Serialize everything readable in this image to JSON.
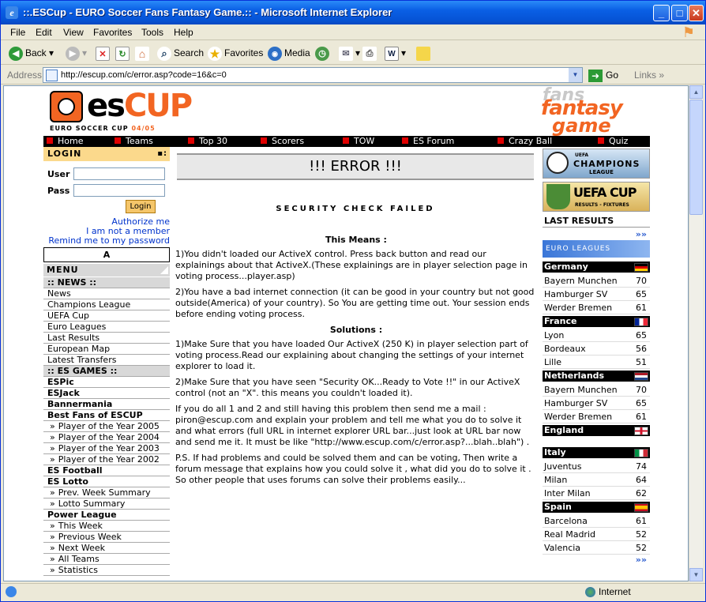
{
  "window": {
    "title": "::.ESCup - EURO Soccer Fans Fantasy Game.::  - Microsoft Internet Explorer"
  },
  "menubar": [
    "File",
    "Edit",
    "View",
    "Favorites",
    "Tools",
    "Help"
  ],
  "toolbar": {
    "back": "Back",
    "search": "Search",
    "favorites": "Favorites",
    "media": "Media"
  },
  "address": {
    "label": "Address",
    "url": "http://escup.com/c/error.asp?code=16&c=0",
    "go": "Go",
    "links": "Links"
  },
  "status": {
    "zone": "Internet"
  },
  "site": {
    "logo": {
      "es": "es",
      "cup": "CUP",
      "sub": "EURO SOCCER CUP",
      "season": "04/05"
    },
    "fflogo": {
      "l1": "fans",
      "l2": "fantasy",
      "l3": "game"
    },
    "nav": [
      "Home",
      "Teams",
      "Top 30",
      "Scorers",
      "TOW",
      "ES Forum",
      "Crazy Ball",
      "Quiz"
    ]
  },
  "left": {
    "login_title": "LOGIN",
    "user_label": "User",
    "pass_label": "Pass",
    "login_button": "Login",
    "links": [
      "Authorize me",
      "I am not a member",
      "Remind me to my password"
    ],
    "a_box": "A",
    "menu_title": "MENU",
    "menu": [
      {
        "t": "sec",
        "label": ":: NEWS ::"
      },
      {
        "t": "item",
        "label": "News"
      },
      {
        "t": "item",
        "label": "Champions League"
      },
      {
        "t": "item",
        "label": "UEFA Cup"
      },
      {
        "t": "item",
        "label": "Euro Leagues"
      },
      {
        "t": "item",
        "label": "Last Results"
      },
      {
        "t": "item",
        "label": "European Map"
      },
      {
        "t": "item",
        "label": "Latest Transfers"
      },
      {
        "t": "sec",
        "label": ":: ES GAMES ::"
      },
      {
        "t": "bold",
        "label": "ESPic"
      },
      {
        "t": "bold",
        "label": "ESJack"
      },
      {
        "t": "bold",
        "label": "Bannermania"
      },
      {
        "t": "bold",
        "label": "Best Fans of ESCUP"
      },
      {
        "t": "sub",
        "label": "Player of the Year 2005"
      },
      {
        "t": "sub",
        "label": "Player of the Year 2004"
      },
      {
        "t": "sub",
        "label": "Player of the Year 2003"
      },
      {
        "t": "sub",
        "label": "Player of the Year 2002"
      },
      {
        "t": "bold",
        "label": "ES Football"
      },
      {
        "t": "bold",
        "label": "ES Lotto"
      },
      {
        "t": "sub",
        "label": "Prev. Week Summary"
      },
      {
        "t": "sub",
        "label": "Lotto Summary"
      },
      {
        "t": "bold",
        "label": "Power League"
      },
      {
        "t": "sub",
        "label": "This Week"
      },
      {
        "t": "sub",
        "label": "Previous Week"
      },
      {
        "t": "sub",
        "label": "Next Week"
      },
      {
        "t": "sub",
        "label": "All Teams"
      },
      {
        "t": "sub",
        "label": "Statistics"
      }
    ]
  },
  "center": {
    "error_title": "!!! ERROR !!!",
    "security": "SECURITY CHECK FAILED",
    "means_title": "This Means :",
    "means": [
      "1)You didn't loaded our ActiveX control. Press back button and read our explainings about that ActiveX.(These explainings are in player selection page in voting process...player.asp)",
      "2)You have a bad internet connection (it can be good in your country but not good outside(America) of your country). So You are getting time out. Your session ends before ending voting process."
    ],
    "solutions_title": "Solutions :",
    "solutions": [
      "1)Make Sure that you have loaded Our ActiveX (250 K) in player selection part of voting process.Read our explaining about changing the settings of your internet explorer to load it.",
      "2)Make Sure that you have seen \"Security OK...Ready to Vote !!\" in our ActiveX control (not an \"X\". this means you couldn't loaded it).",
      "If you do all 1 and 2 and still having this problem then send me a mail : piron@escup.com and explain your problem and tell me what you do to solve it and what errors (full URL in internet explorer URL bar...just look at URL bar now and send me it. It must be like \"http://www.escup.com/c/error.asp?...blah..blah\") .",
      "P.S. If had problems and could be solved them and can be voting, Then write a forum message that explains how you could solve it , what did you do to solve it . So other people that uses forums can solve their problems easily..."
    ]
  },
  "right": {
    "cl": {
      "t1": "UEFA",
      "t2": "CHAMPIONS",
      "t3": "LEAGUE"
    },
    "uc": {
      "t2": "UEFA CUP",
      "t3": "RESULTS - FIXTURES"
    },
    "last_results": "LAST RESULTS",
    "more": "»»",
    "euro_leagues": "EURO LEAGUES",
    "leagues": [
      {
        "country": "Germany",
        "flag": "de",
        "teams": [
          {
            "n": "Bayern Munchen",
            "p": "70"
          },
          {
            "n": "Hamburger SV",
            "p": "65"
          },
          {
            "n": "Werder Bremen",
            "p": "61"
          }
        ]
      },
      {
        "country": "France",
        "flag": "fr",
        "teams": [
          {
            "n": "Lyon",
            "p": "65"
          },
          {
            "n": "Bordeaux",
            "p": "56"
          },
          {
            "n": "Lille",
            "p": "51"
          }
        ]
      },
      {
        "country": "Netherlands",
        "flag": "nl",
        "teams": [
          {
            "n": "Bayern Munchen",
            "p": "70"
          },
          {
            "n": "Hamburger SV",
            "p": "65"
          },
          {
            "n": "Werder Bremen",
            "p": "61"
          }
        ]
      },
      {
        "country": "England",
        "flag": "en",
        "teams": []
      },
      {
        "country": "Italy",
        "flag": "it",
        "teams": [
          {
            "n": "Juventus",
            "p": "74"
          },
          {
            "n": "Milan",
            "p": "64"
          },
          {
            "n": "Inter Milan",
            "p": "62"
          }
        ]
      },
      {
        "country": "Spain",
        "flag": "es",
        "teams": [
          {
            "n": "Barcelona",
            "p": "61"
          },
          {
            "n": "Real Madrid",
            "p": "52"
          },
          {
            "n": "Valencia",
            "p": "52"
          }
        ]
      }
    ]
  }
}
